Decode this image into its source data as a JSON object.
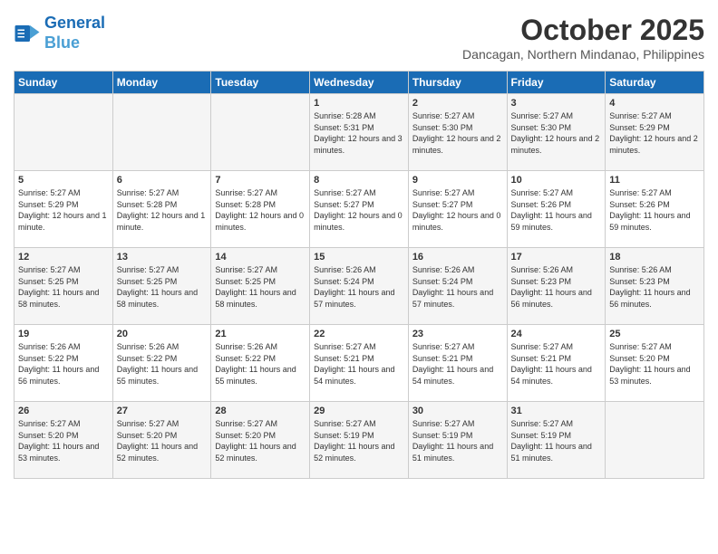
{
  "header": {
    "logo_line1": "General",
    "logo_line2": "Blue",
    "month": "October 2025",
    "location": "Dancagan, Northern Mindanao, Philippines"
  },
  "days_of_week": [
    "Sunday",
    "Monday",
    "Tuesday",
    "Wednesday",
    "Thursday",
    "Friday",
    "Saturday"
  ],
  "weeks": [
    [
      {
        "day": "",
        "info": ""
      },
      {
        "day": "",
        "info": ""
      },
      {
        "day": "",
        "info": ""
      },
      {
        "day": "1",
        "info": "Sunrise: 5:28 AM\nSunset: 5:31 PM\nDaylight: 12 hours and 3 minutes."
      },
      {
        "day": "2",
        "info": "Sunrise: 5:27 AM\nSunset: 5:30 PM\nDaylight: 12 hours and 2 minutes."
      },
      {
        "day": "3",
        "info": "Sunrise: 5:27 AM\nSunset: 5:30 PM\nDaylight: 12 hours and 2 minutes."
      },
      {
        "day": "4",
        "info": "Sunrise: 5:27 AM\nSunset: 5:29 PM\nDaylight: 12 hours and 2 minutes."
      }
    ],
    [
      {
        "day": "5",
        "info": "Sunrise: 5:27 AM\nSunset: 5:29 PM\nDaylight: 12 hours and 1 minute."
      },
      {
        "day": "6",
        "info": "Sunrise: 5:27 AM\nSunset: 5:28 PM\nDaylight: 12 hours and 1 minute."
      },
      {
        "day": "7",
        "info": "Sunrise: 5:27 AM\nSunset: 5:28 PM\nDaylight: 12 hours and 0 minutes."
      },
      {
        "day": "8",
        "info": "Sunrise: 5:27 AM\nSunset: 5:27 PM\nDaylight: 12 hours and 0 minutes."
      },
      {
        "day": "9",
        "info": "Sunrise: 5:27 AM\nSunset: 5:27 PM\nDaylight: 12 hours and 0 minutes."
      },
      {
        "day": "10",
        "info": "Sunrise: 5:27 AM\nSunset: 5:26 PM\nDaylight: 11 hours and 59 minutes."
      },
      {
        "day": "11",
        "info": "Sunrise: 5:27 AM\nSunset: 5:26 PM\nDaylight: 11 hours and 59 minutes."
      }
    ],
    [
      {
        "day": "12",
        "info": "Sunrise: 5:27 AM\nSunset: 5:25 PM\nDaylight: 11 hours and 58 minutes."
      },
      {
        "day": "13",
        "info": "Sunrise: 5:27 AM\nSunset: 5:25 PM\nDaylight: 11 hours and 58 minutes."
      },
      {
        "day": "14",
        "info": "Sunrise: 5:27 AM\nSunset: 5:25 PM\nDaylight: 11 hours and 58 minutes."
      },
      {
        "day": "15",
        "info": "Sunrise: 5:26 AM\nSunset: 5:24 PM\nDaylight: 11 hours and 57 minutes."
      },
      {
        "day": "16",
        "info": "Sunrise: 5:26 AM\nSunset: 5:24 PM\nDaylight: 11 hours and 57 minutes."
      },
      {
        "day": "17",
        "info": "Sunrise: 5:26 AM\nSunset: 5:23 PM\nDaylight: 11 hours and 56 minutes."
      },
      {
        "day": "18",
        "info": "Sunrise: 5:26 AM\nSunset: 5:23 PM\nDaylight: 11 hours and 56 minutes."
      }
    ],
    [
      {
        "day": "19",
        "info": "Sunrise: 5:26 AM\nSunset: 5:22 PM\nDaylight: 11 hours and 56 minutes."
      },
      {
        "day": "20",
        "info": "Sunrise: 5:26 AM\nSunset: 5:22 PM\nDaylight: 11 hours and 55 minutes."
      },
      {
        "day": "21",
        "info": "Sunrise: 5:26 AM\nSunset: 5:22 PM\nDaylight: 11 hours and 55 minutes."
      },
      {
        "day": "22",
        "info": "Sunrise: 5:27 AM\nSunset: 5:21 PM\nDaylight: 11 hours and 54 minutes."
      },
      {
        "day": "23",
        "info": "Sunrise: 5:27 AM\nSunset: 5:21 PM\nDaylight: 11 hours and 54 minutes."
      },
      {
        "day": "24",
        "info": "Sunrise: 5:27 AM\nSunset: 5:21 PM\nDaylight: 11 hours and 54 minutes."
      },
      {
        "day": "25",
        "info": "Sunrise: 5:27 AM\nSunset: 5:20 PM\nDaylight: 11 hours and 53 minutes."
      }
    ],
    [
      {
        "day": "26",
        "info": "Sunrise: 5:27 AM\nSunset: 5:20 PM\nDaylight: 11 hours and 53 minutes."
      },
      {
        "day": "27",
        "info": "Sunrise: 5:27 AM\nSunset: 5:20 PM\nDaylight: 11 hours and 52 minutes."
      },
      {
        "day": "28",
        "info": "Sunrise: 5:27 AM\nSunset: 5:20 PM\nDaylight: 11 hours and 52 minutes."
      },
      {
        "day": "29",
        "info": "Sunrise: 5:27 AM\nSunset: 5:19 PM\nDaylight: 11 hours and 52 minutes."
      },
      {
        "day": "30",
        "info": "Sunrise: 5:27 AM\nSunset: 5:19 PM\nDaylight: 11 hours and 51 minutes."
      },
      {
        "day": "31",
        "info": "Sunrise: 5:27 AM\nSunset: 5:19 PM\nDaylight: 11 hours and 51 minutes."
      },
      {
        "day": "",
        "info": ""
      }
    ]
  ]
}
